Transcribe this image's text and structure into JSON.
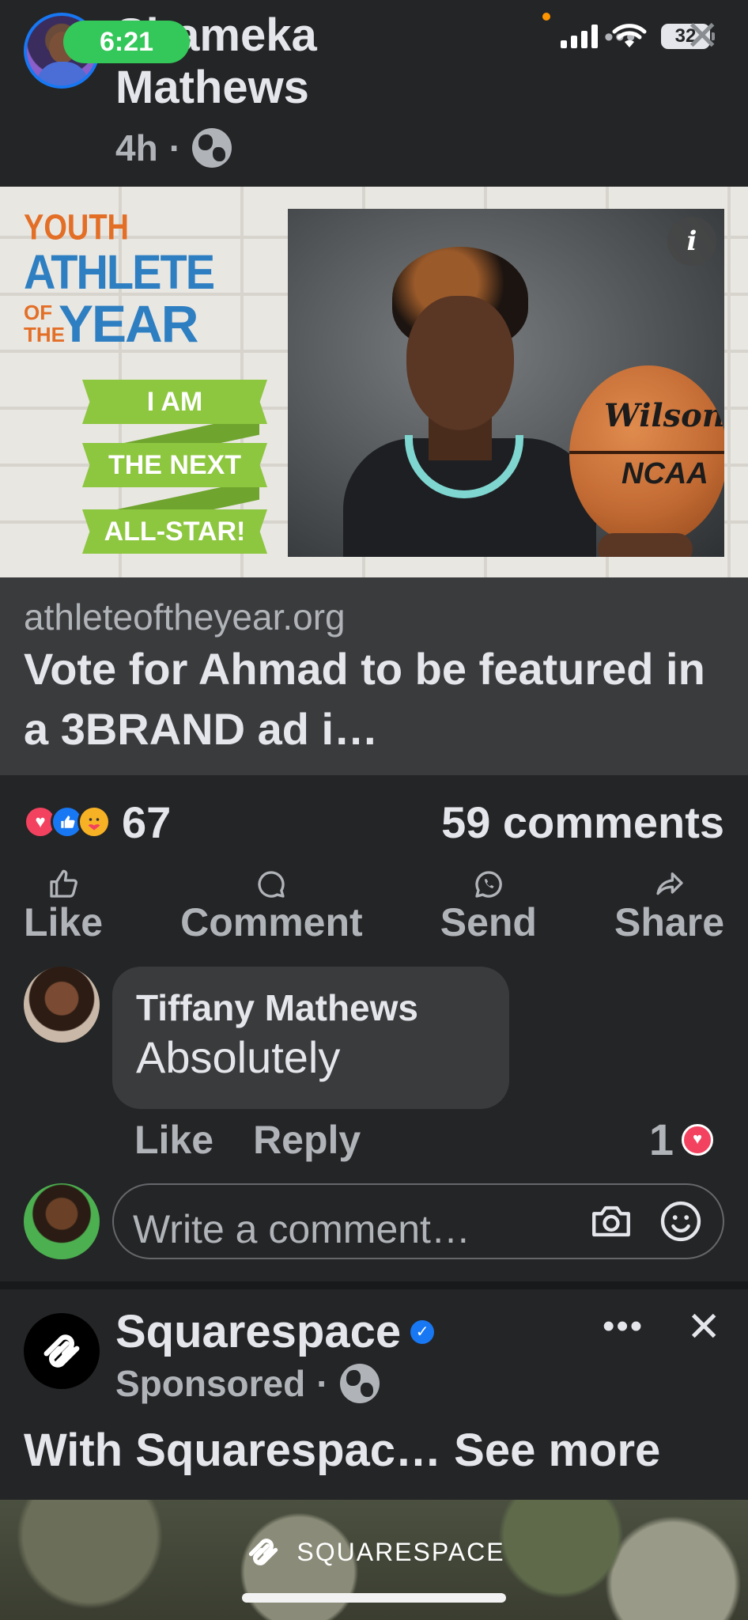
{
  "status_bar": {
    "time": "6:21",
    "battery": "32"
  },
  "post": {
    "author": "Shameka Mathews",
    "author_visible": "Shameka\nMathews",
    "age": "4h",
    "separator": "·",
    "link": {
      "domain": "athleteoftheyear.org",
      "title": "Vote for Ahmad to be featured in a 3BRAND ad i…"
    },
    "creative": {
      "brand_youth": "YOUTH",
      "brand_athlete": "ATHLETE",
      "brand_of": "OF",
      "brand_the": "THE",
      "brand_year": "YEAR",
      "ribbon_1": "I AM",
      "ribbon_2": "THE NEXT",
      "ribbon_3": "ALL-STAR!",
      "ball_brand": "Wilson",
      "ball_league": "NCAA",
      "info_glyph": "i"
    },
    "reaction_count": "67",
    "comments_count": "59 comments",
    "actions": {
      "like": "Like",
      "comment": "Comment",
      "send": "Send",
      "share": "Share"
    }
  },
  "comment": {
    "author": "Tiffany Mathews",
    "text": "Absolutely",
    "like": "Like",
    "reply": "Reply",
    "reaction_count": "1"
  },
  "composer": {
    "placeholder": "Write a comment…"
  },
  "ad": {
    "name": "Squarespace",
    "sponsored": "Sponsored",
    "separator": "·",
    "text": "With Squarespac…",
    "see_more": "See more",
    "media_brand": "SQUARESPACE"
  },
  "colors": {
    "accent": "#1877f2",
    "background": "#242526",
    "card": "#3a3b3c",
    "ribbon": "#8dc63f",
    "status_green": "#34c759"
  }
}
